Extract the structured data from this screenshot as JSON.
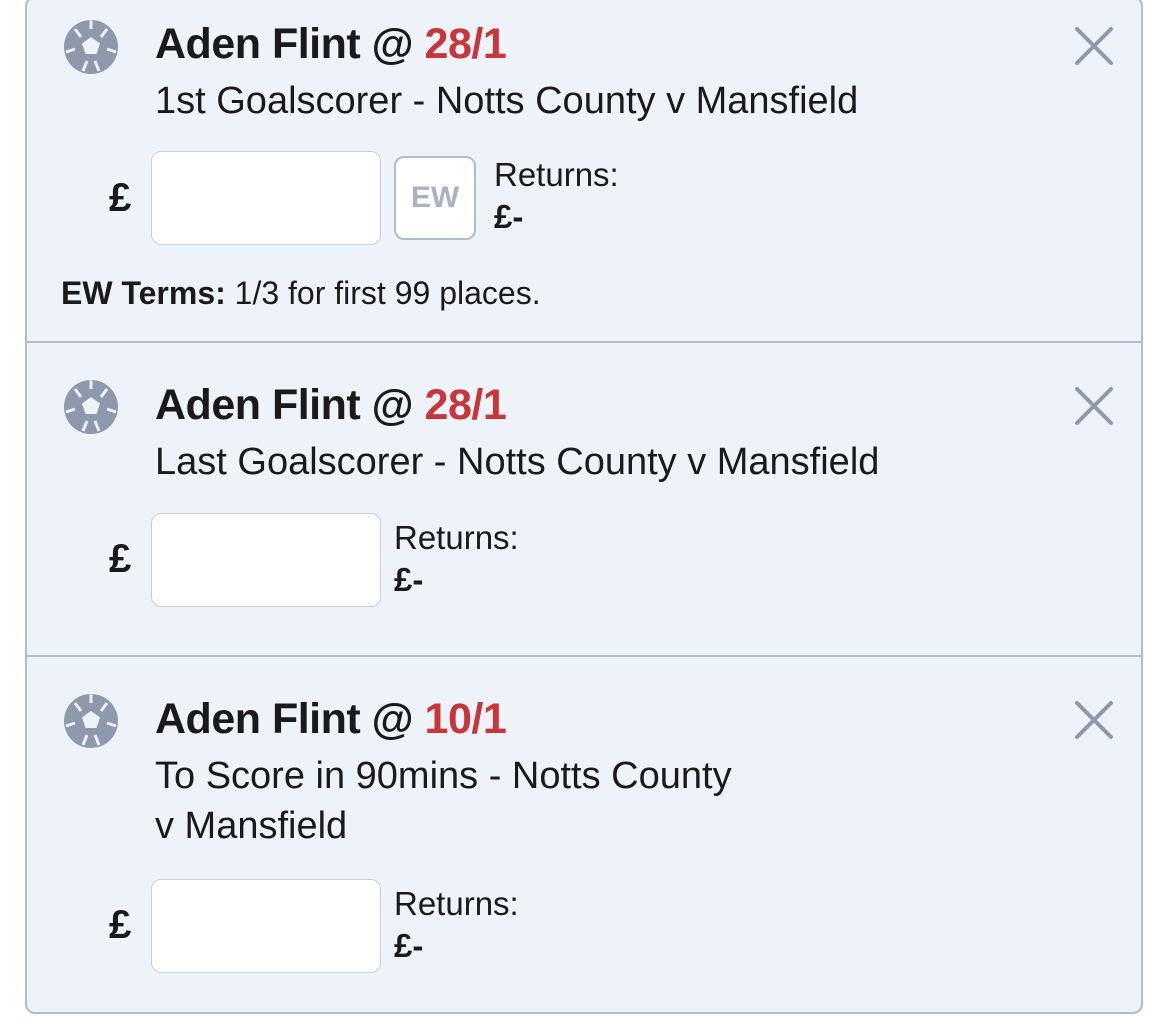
{
  "bets": [
    {
      "icon": "football-icon",
      "selection": "Aden Flint",
      "at": "@",
      "odds": "28/1",
      "market_line1": "1st Goalscorer - Notts County v Mansfield",
      "market_line2": "",
      "currency": "£",
      "stake_value": "",
      "ew_label": "EW",
      "returns_label": "Returns:",
      "returns_value": "£-",
      "ew_terms_label": "EW Terms:",
      "ew_terms_text": "1/3 for first 99 places."
    },
    {
      "icon": "football-icon",
      "selection": "Aden Flint",
      "at": "@",
      "odds": "28/1",
      "market_line1": "Last Goalscorer - Notts County v Mansfield",
      "market_line2": "",
      "currency": "£",
      "stake_value": "",
      "returns_label": "Returns:",
      "returns_value": "£-"
    },
    {
      "icon": "football-icon",
      "selection": "Aden Flint",
      "at": "@",
      "odds": "10/1",
      "market_line1": "To Score in 90mins - Notts County",
      "market_line2": "v Mansfield",
      "currency": "£",
      "stake_value": "",
      "returns_label": "Returns:",
      "returns_value": "£-"
    }
  ],
  "colors": {
    "odds": "#c8353a",
    "panel_background": "#eef2f9",
    "border": "#b3bccb",
    "icon": "#8e99ad"
  }
}
